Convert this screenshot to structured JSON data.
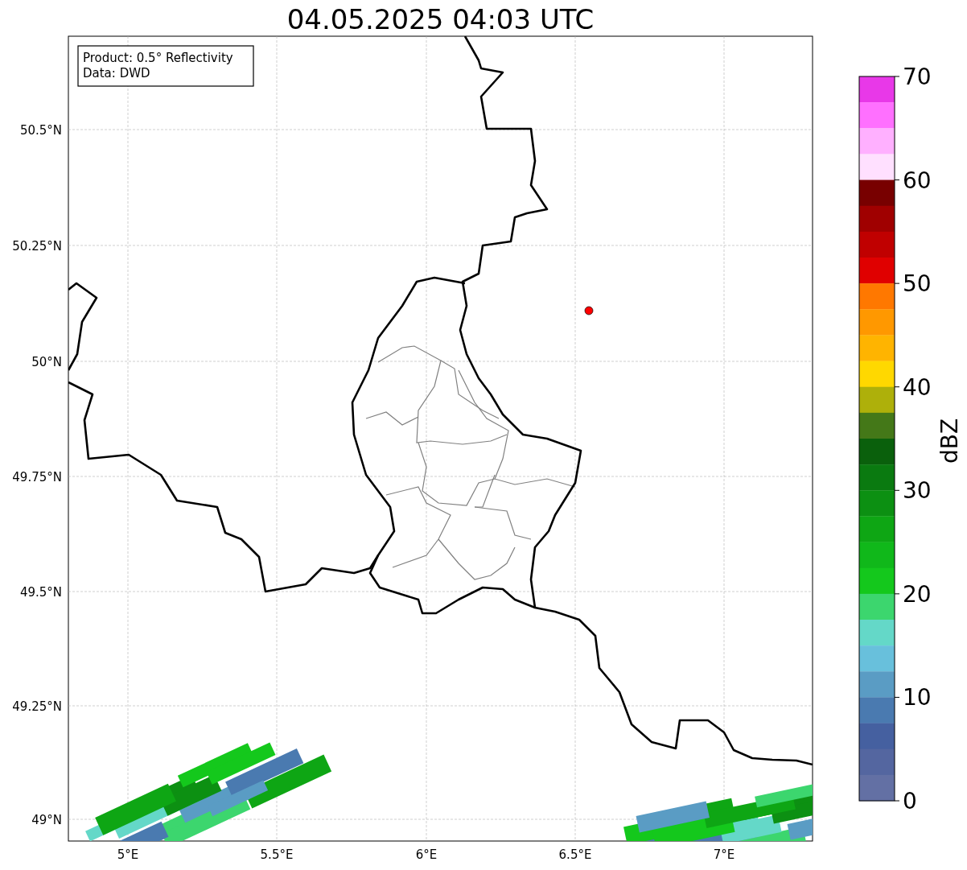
{
  "title": "04.05.2025 04:03 UTC",
  "info_box": {
    "lines": [
      "Product: 0.5° Reflectivity",
      "Data: DWD"
    ]
  },
  "map": {
    "xtick_labels": [
      "5°E",
      "5.5°E",
      "6°E",
      "6.5°E",
      "7°E"
    ],
    "ytick_labels": [
      "50.5°N",
      "50.25°N",
      "50°N",
      "49.75°N",
      "49.5°N",
      "49.25°N",
      "49°N"
    ]
  },
  "colorbar": {
    "label": "dBZ",
    "tick_labels": [
      "70",
      "60",
      "50",
      "40",
      "30",
      "20",
      "10",
      "0"
    ],
    "bands": [
      {
        "color": "#e838e8"
      },
      {
        "color": "#ff70ff"
      },
      {
        "color": "#ffb0ff"
      },
      {
        "color": "#ffe0ff"
      },
      {
        "color": "#780000"
      },
      {
        "color": "#a00000"
      },
      {
        "color": "#c00000"
      },
      {
        "color": "#e00000"
      },
      {
        "color": "#ff7800"
      },
      {
        "color": "#ff9800"
      },
      {
        "color": "#ffb400"
      },
      {
        "color": "#ffd800"
      },
      {
        "color": "#aeb00a"
      },
      {
        "color": "#447818"
      },
      {
        "color": "#0a600c"
      },
      {
        "color": "#0a7a10"
      },
      {
        "color": "#0c9012"
      },
      {
        "color": "#0ea614"
      },
      {
        "color": "#10b81a"
      },
      {
        "color": "#14c81c"
      },
      {
        "color": "#3cd66e"
      },
      {
        "color": "#64d8c8"
      },
      {
        "color": "#68c0dc"
      },
      {
        "color": "#5a9cc4"
      },
      {
        "color": "#4a7ab0"
      },
      {
        "color": "#4560a0"
      },
      {
        "color": "#5466a0"
      },
      {
        "color": "#6370a4"
      }
    ]
  }
}
